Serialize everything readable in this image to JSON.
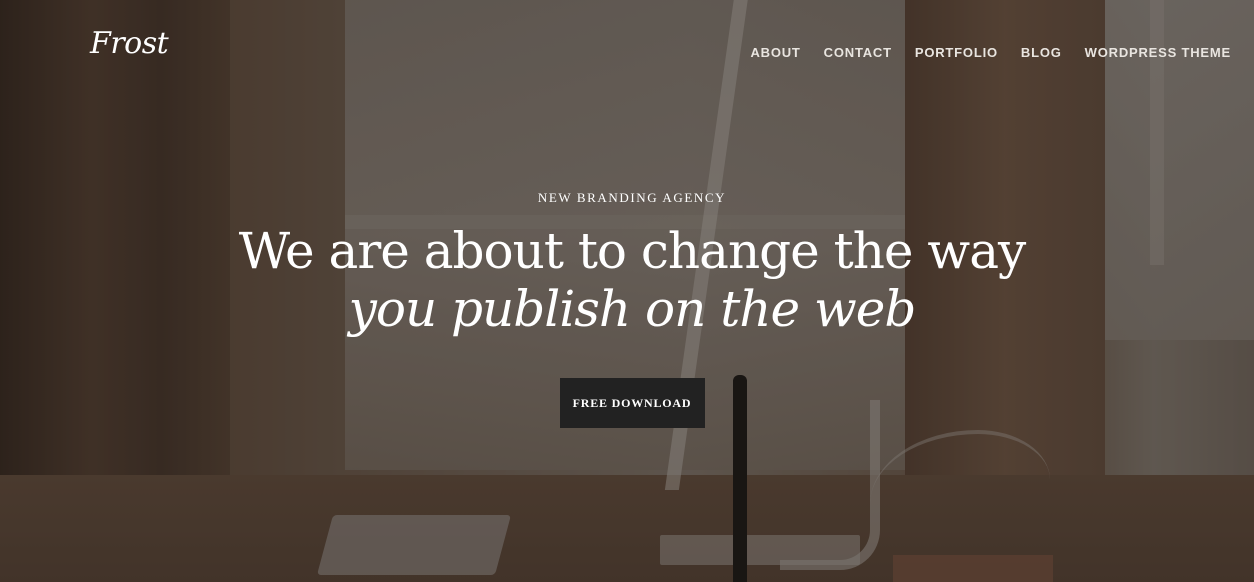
{
  "header": {
    "logo_text": "Frost",
    "nav": [
      {
        "label": "ABOUT"
      },
      {
        "label": "CONTACT"
      },
      {
        "label": "PORTFOLIO"
      },
      {
        "label": "BLOG"
      },
      {
        "label": "WORDPRESS THEME"
      }
    ]
  },
  "hero": {
    "kicker": "NEW BRANDING AGENCY",
    "headline_line1": "We are about to change the way",
    "headline_line2": "you publish on the web",
    "cta_label": "FREE DOWNLOAD"
  },
  "colors": {
    "overlay": "#14100d",
    "cta_background": "#222222",
    "text": "#ffffff"
  }
}
